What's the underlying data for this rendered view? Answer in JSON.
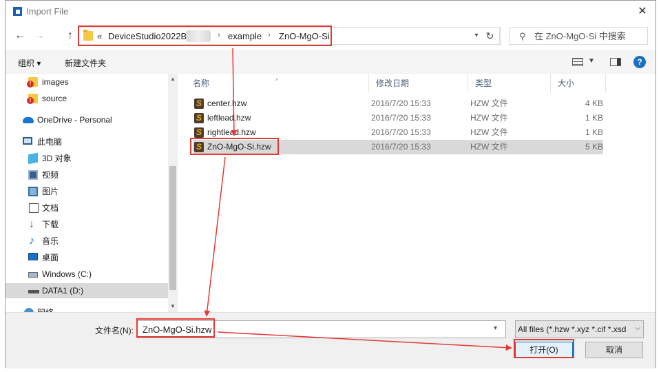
{
  "window": {
    "title": "Import File"
  },
  "nav": {
    "back": "←",
    "forward": "→",
    "up": "↑",
    "refresh": "↻"
  },
  "address": {
    "chevrons": "«",
    "crumbs": [
      "DeviceStudio2022B",
      "example",
      "ZnO-MgO-Si"
    ],
    "separator": "›"
  },
  "search": {
    "placeholder": "在 ZnO-MgO-Si 中搜索"
  },
  "toolbar": {
    "organize": "组织 ▾",
    "new_folder": "新建文件夹",
    "help": "?"
  },
  "sidebar": {
    "items": [
      {
        "label": "images",
        "icon": "folder-warning-icon"
      },
      {
        "label": "source",
        "icon": "folder-warning-icon"
      },
      {
        "label": "OneDrive - Personal",
        "icon": "cloud-icon"
      },
      {
        "label": "此电脑",
        "icon": "computer-icon"
      },
      {
        "label": "3D 对象",
        "icon": "3d-objects-icon"
      },
      {
        "label": "视频",
        "icon": "video-icon"
      },
      {
        "label": "图片",
        "icon": "picture-icon"
      },
      {
        "label": "文档",
        "icon": "document-icon"
      },
      {
        "label": "下载",
        "icon": "download-icon"
      },
      {
        "label": "音乐",
        "icon": "music-icon"
      },
      {
        "label": "桌面",
        "icon": "desktop-icon"
      },
      {
        "label": "Windows (C:)",
        "icon": "drive-icon"
      },
      {
        "label": "DATA1 (D:)",
        "icon": "drive-icon"
      },
      {
        "label": "网络",
        "icon": "network-icon"
      }
    ]
  },
  "columns": [
    "名称",
    "修改日期",
    "类型",
    "大小"
  ],
  "files": [
    {
      "name": "center.hzw",
      "date": "2016/7/20 15:33",
      "type": "HZW 文件",
      "size": "4 KB"
    },
    {
      "name": "leftlead.hzw",
      "date": "2016/7/20 15:33",
      "type": "HZW 文件",
      "size": "1 KB"
    },
    {
      "name": "rightlead.hzw",
      "date": "2016/7/20 15:33",
      "type": "HZW 文件",
      "size": "1 KB"
    },
    {
      "name": "ZnO-MgO-Si.hzw",
      "date": "2016/7/20 15:33",
      "type": "HZW 文件",
      "size": "5 KB"
    }
  ],
  "file_icon_glyph": "S",
  "bottom": {
    "filename_label": "文件名(N):",
    "filename_value": "ZnO-MgO-Si.hzw",
    "filetype": "All files (*.hzw *.xyz *.cif *.xsd",
    "open": "打开(O)",
    "cancel": "取消"
  },
  "colors": {
    "annotation": "#e53935",
    "selection": "#d9d9d9",
    "accent": "#0078d7"
  }
}
